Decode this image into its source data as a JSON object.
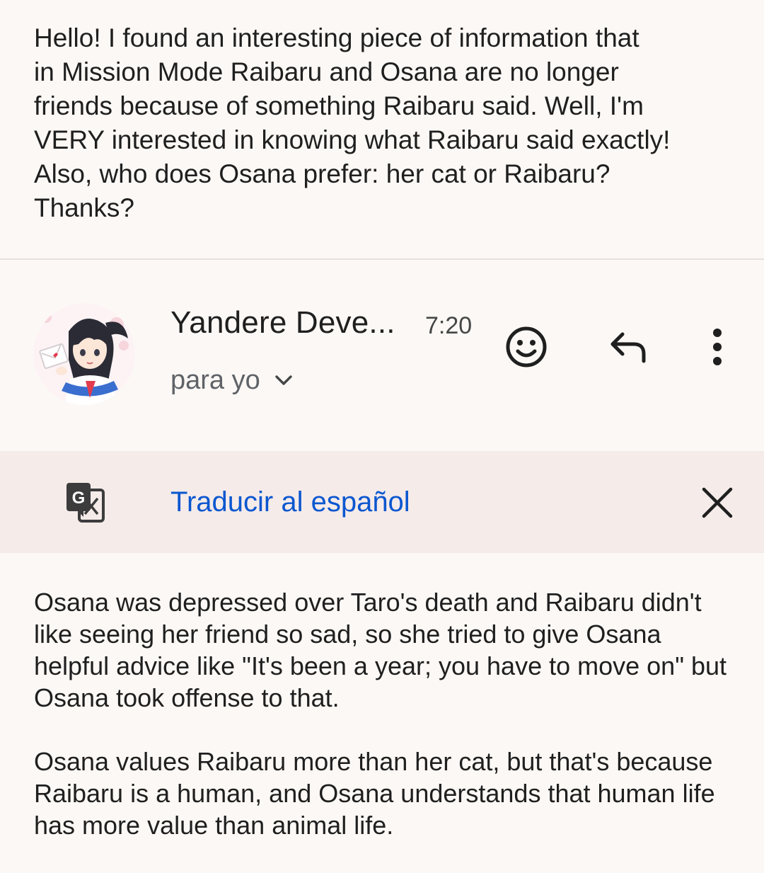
{
  "previous_message": {
    "text": "Hello! I found an interesting piece of information that\nin Mission Mode Raibaru and Osana are no longer\nfriends because of something Raibaru said. Well, I'm\nVERY interested in knowing what Raibaru said exactly!\nAlso, who does Osana prefer: her cat or Raibaru?\nThanks?"
  },
  "message_header": {
    "sender_name": "Yandere Deve...",
    "time": "7:20",
    "recipient_label": "para yo",
    "avatar_icon": "avatar-anime-girl",
    "actions": {
      "emoji_icon": "smiley-icon",
      "reply_icon": "reply-icon",
      "more_icon": "more-vert-icon"
    }
  },
  "translate_bar": {
    "label": "Traducir al español",
    "icon": "google-translate-icon",
    "close_icon": "close-icon",
    "link_color": "#0b57d0"
  },
  "message_body": {
    "paragraphs": [
      "Osana was depressed over Taro's death and Raibaru didn't like seeing her friend so sad, so she tried to give Osana helpful advice like \"It's been a year; you have to move on\" but Osana took offense to that.",
      "Osana values Raibaru more than her cat, but that's because Raibaru is a human, and Osana understands that human life has more value than animal life."
    ]
  }
}
